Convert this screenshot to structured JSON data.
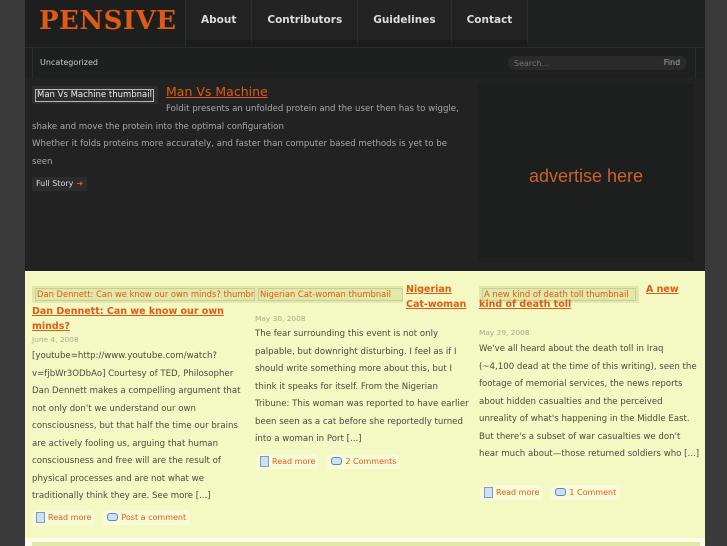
{
  "header": {
    "logo": "PENSIVE",
    "nav": [
      "About",
      "Contributors",
      "Guidelines",
      "Contact"
    ]
  },
  "subbar": {
    "category": "Uncategorized",
    "search_placeholder": "Search...",
    "find_label": "Find"
  },
  "featured": {
    "thumbnail_alt": "Man Vs Machine thumbnail",
    "title": "Man Vs Machine",
    "paragraphs": [
      "Foldit presents an unfolded protein and the user then has to wiggle, shake and move the protein into the optimal configuration",
      "Whether it folds proteins more accurately, and faster than computer based methods is yet to be seen"
    ],
    "full_story_label": "Full Story",
    "arrow_icon": "arrow-right-icon"
  },
  "ad": {
    "text": "advertise here"
  },
  "posts": [
    {
      "thumbnail_alt": "Dan Dennett: Can we know our own minds? thumbnail",
      "title": "Dan Dennett: Can we know our own minds?",
      "date": "June 4, 2008",
      "excerpt": "[youtube=http://www.youtube.com/watch?v=fjbWr3ODbAo] Courtesy of TED, Philosopher Dan Dennett makes a compelling argument that not only don't we understand our own consciousness, but that half the time our brains are actively fooling us, arguing that human consciousness and free will are the result of physical processes and are not what we traditionally think they are. See more [...]",
      "read_more": "Read more",
      "comments": "Post a comment"
    },
    {
      "thumbnail_alt": "Nigerian Cat-woman thumbnail",
      "title": "Nigerian Cat-woman",
      "date": "May 30, 2008",
      "excerpt": "The fear surrounding this event is not only palpable, but downright disturbing. I feel as if I should write something more about this, but I think it speaks for itself. From the Nigerian Tribune: This woman was reported to have earlier been seen as a cat before she reportedly turned into a woman in Port [...]",
      "read_more": "Read more",
      "comments": "2 Comments"
    },
    {
      "thumbnail_alt": "A new kind of death toll thumbnail",
      "title": "A new kind of death toll",
      "date": "May 29, 2008",
      "excerpt": "We've all heard about the death toll in Iraq (~4,100 dead at the time of this writing), seen the footage of memorial services, the news reports about hidden casualties and the perceived unreality of what's happening in the Middle East. But there's a subset of war casualties we don't hear much about—those returned soldiers who [...]",
      "read_more": "Read more",
      "comments": "1 Comment"
    }
  ],
  "colors": {
    "accent": "#e05a14",
    "dark_bg": "#222222",
    "posts_bg": "#f4f8c2"
  }
}
